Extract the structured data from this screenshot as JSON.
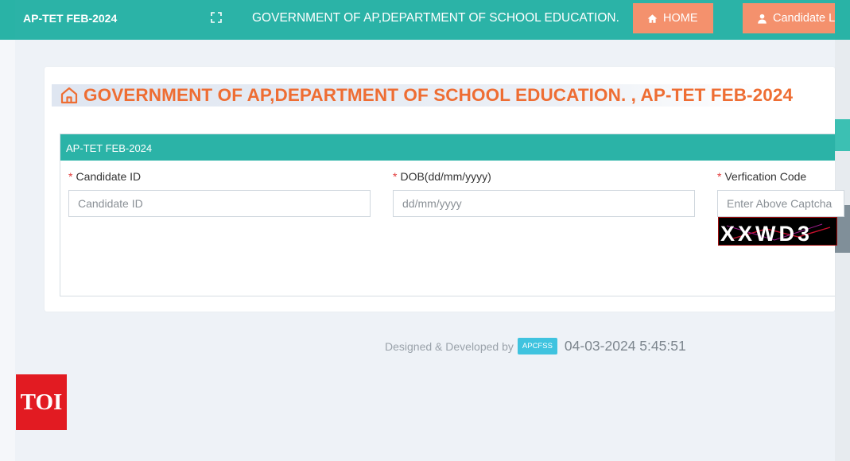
{
  "navbar": {
    "brand": "AP-TET FEB-2024",
    "title": "GOVERNMENT OF AP,DEPARTMENT OF SCHOOL EDUCATION.",
    "home_label": "HOME",
    "candidate_label": "Candidate L",
    "icons": [
      "fullscreen-icon",
      "home-icon",
      "user-icon"
    ]
  },
  "heading": {
    "text": "GOVERNMENT OF AP,DEPARTMENT OF SCHOOL EDUCATION. , AP-TET FEB-2024",
    "icon": "home-outline-icon"
  },
  "panel": {
    "title": "AP-TET FEB-2024",
    "fields": [
      {
        "label": "Candidate ID",
        "placeholder": "Candidate ID",
        "required_mark": "*"
      },
      {
        "label": "DOB(dd/mm/yyyy)",
        "placeholder": "dd/mm/yyyy",
        "required_mark": "*"
      },
      {
        "label": "Verfication Code",
        "placeholder": "Enter Above Captcha",
        "required_mark": "*"
      }
    ],
    "captcha_text": "XXWD3"
  },
  "footer": {
    "credit": "Designed & Developed by",
    "badge": "APCFSS",
    "timestamp": "04-03-2024 5:45:51"
  },
  "watermark": {
    "text": "TOI"
  },
  "colors": {
    "header_teal": "#2bb3a7",
    "button_orange": "#f4916d",
    "heading_orange": "#ee6d33",
    "badge_cyan": "#3fc3df",
    "required_red": "#e23b3b",
    "page_bg": "#eef2f7"
  }
}
